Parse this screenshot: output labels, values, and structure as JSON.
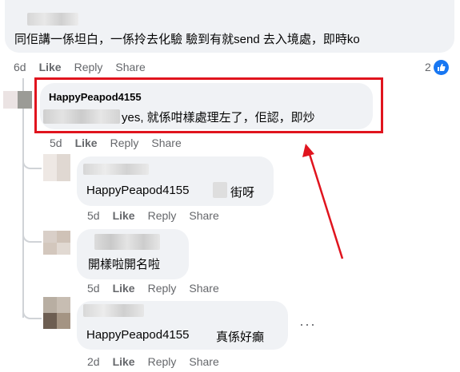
{
  "colors": {
    "bubble": "#f0f2f5",
    "meta_text": "#65676b",
    "highlight_box": "#e0141e",
    "arrow": "#e0141e",
    "like_badge": "#1877f2"
  },
  "top_comment": {
    "text": "同佢講一係坦白，一係拎去化驗 驗到有就send 去入境處，即時ko",
    "time": "6d",
    "like": "Like",
    "reply": "Reply",
    "share": "Share",
    "reaction_count": "2",
    "reaction_icon": "thumbs-up-icon"
  },
  "reply_highlighted": {
    "author": "HappyPeapod4155",
    "text": "yes, 就係咁樣處理左了，佢認，即炒",
    "time": "5d",
    "like": "Like",
    "reply": "Reply",
    "share": "Share"
  },
  "nested_replies": [
    {
      "text_name": "HappyPeapod4155",
      "text": "街呀",
      "time": "5d",
      "like": "Like",
      "reply": "Reply",
      "share": "Share"
    },
    {
      "text": "開樣啦開名啦",
      "time": "5d",
      "like": "Like",
      "reply": "Reply",
      "share": "Share"
    },
    {
      "text_name": "HappyPeapod4155",
      "text": "真係好癲",
      "time": "2d",
      "like": "Like",
      "reply": "Reply",
      "share": "Share",
      "more_icon": "more-options-icon"
    }
  ]
}
